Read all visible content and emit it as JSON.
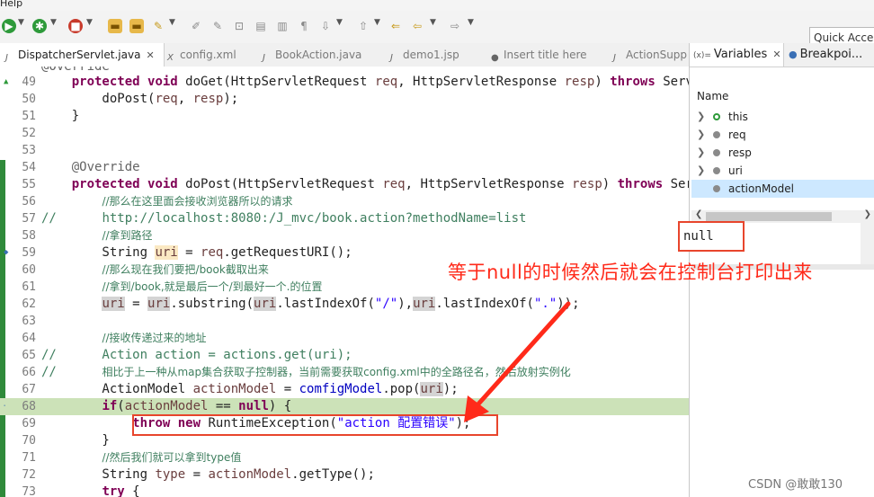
{
  "menu": {
    "label": "Help"
  },
  "toolbar": {
    "quick_access": "Quick Access"
  },
  "editor_tabs": [
    {
      "label": "DispatcherServlet.java",
      "icon": "java-file-icon",
      "active": true
    },
    {
      "label": "config.xml",
      "icon": "xml-file-icon",
      "active": false
    },
    {
      "label": "BookAction.java",
      "icon": "java-file-icon",
      "active": false
    },
    {
      "label": "demo1.jsp",
      "icon": "jsp-file-icon",
      "active": false
    },
    {
      "label": "Insert title here",
      "icon": "globe-icon",
      "active": false
    },
    {
      "label": "ActionSupp",
      "icon": "java-file-icon",
      "active": false
    }
  ],
  "editor": {
    "line_numbers": [
      "49",
      "50",
      "51",
      "52",
      "53",
      "54",
      "55",
      "56",
      "57",
      "58",
      "59",
      "60",
      "61",
      "62",
      "63",
      "64",
      "65",
      "66",
      "67",
      "68",
      "69",
      "70",
      "71",
      "72",
      "73"
    ],
    "top_partial": "@Override",
    "comments": {
      "c56": "//那么在这里面会接收浏览器所以的请求",
      "c57": "http://localhost:8080:/J_mvc/book.action?methodName=list",
      "c58": "//拿到路径",
      "c60": "//那么现在我们要把/book截取出来",
      "c61": "//拿到/book,就是最后一个/到最好一个.的位置",
      "c64": "//接收传递过来的地址",
      "c66": "相比于上一种从map集合获取子控制器，当前需要获取config.xml中的全路径名，然后放射实例化",
      "c71": "//然后我们就可以拿到type值"
    },
    "strings": {
      "slash": "\"/\"",
      "dot": "\".\"",
      "action_error": "\"action 配置错误\""
    }
  },
  "variables_panel": {
    "tabs": [
      {
        "label": "Variables",
        "icon": "variables-icon",
        "active": true
      },
      {
        "label": "Breakpoi...",
        "icon": "breakpoints-icon",
        "active": false
      }
    ],
    "column_header": "Name",
    "rows": [
      {
        "name": "this",
        "icon": "green"
      },
      {
        "name": "req",
        "icon": "gray"
      },
      {
        "name": "resp",
        "icon": "gray"
      },
      {
        "name": "uri",
        "icon": "gray"
      },
      {
        "name": "actionModel",
        "icon": "gray",
        "selected": true
      }
    ],
    "detail_value": "null"
  },
  "annotation": {
    "text": "等于null的时候然后就会在控制台打印出来",
    "color": "#ff2a1a"
  },
  "watermark": "CSDN @敢敢130"
}
